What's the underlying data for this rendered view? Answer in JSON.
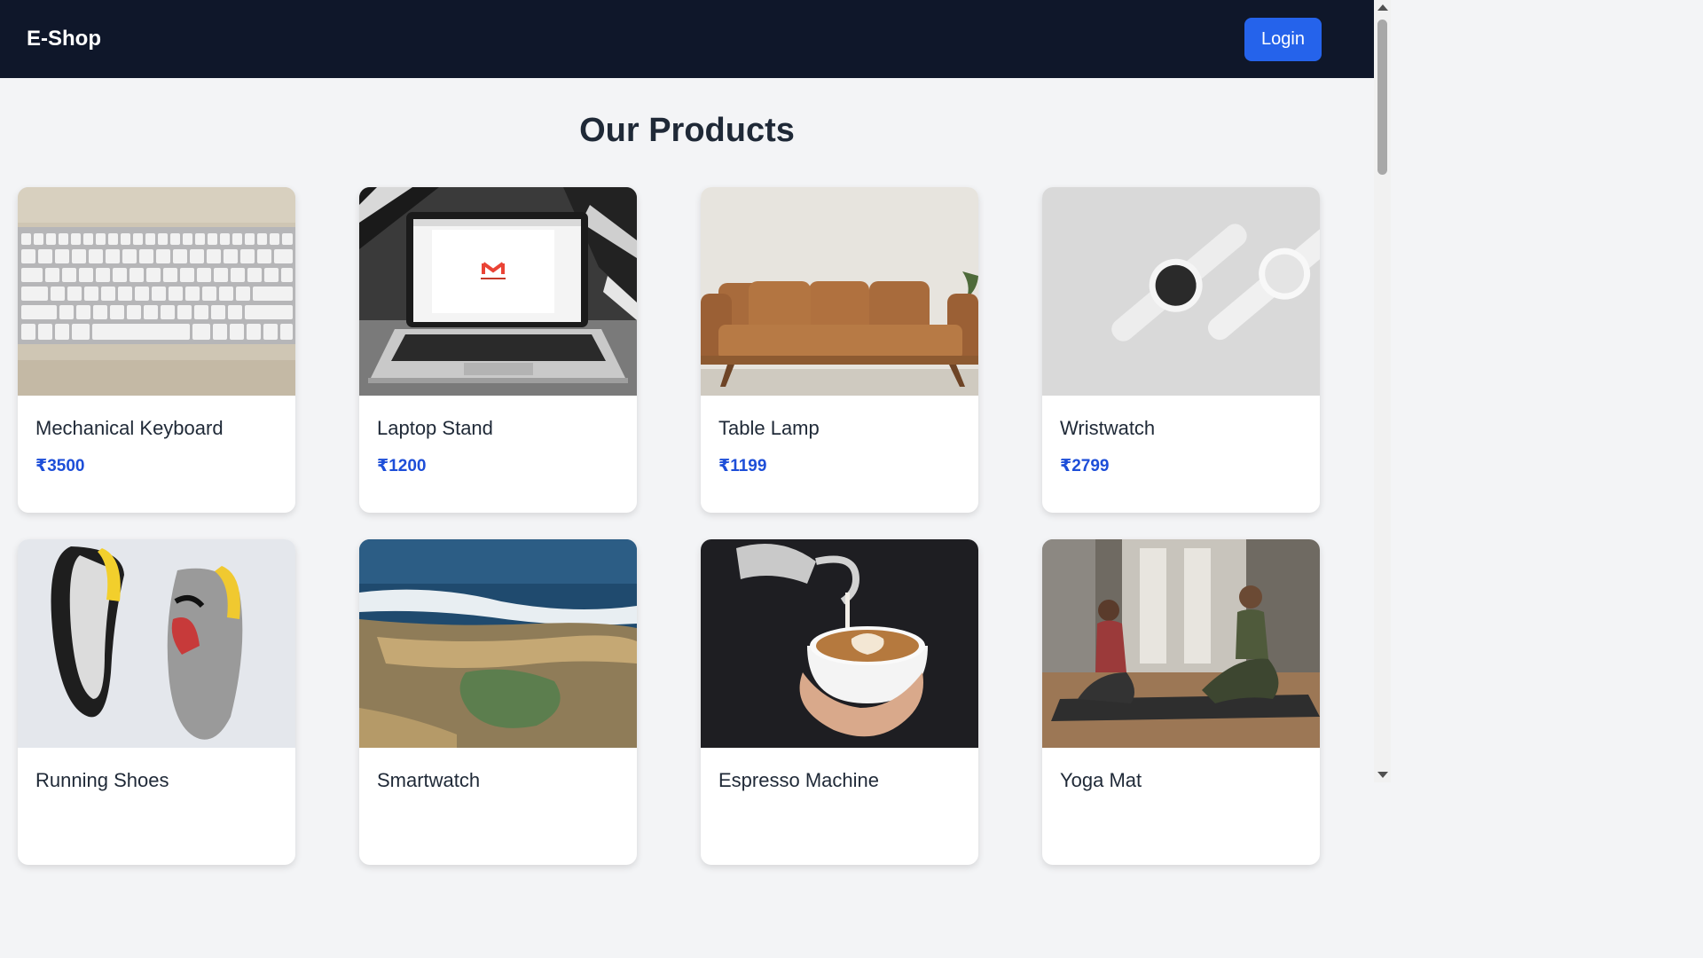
{
  "header": {
    "brand": "E-Shop",
    "login_label": "Login"
  },
  "main": {
    "title": "Our Products",
    "products": [
      {
        "name": "Mechanical Keyboard",
        "price": "₹3500",
        "image": "keyboard-image"
      },
      {
        "name": "Laptop Stand",
        "price": "₹1200",
        "image": "laptop-image"
      },
      {
        "name": "Table Lamp",
        "price": "₹1199",
        "image": "sofa-image"
      },
      {
        "name": "Wristwatch",
        "price": "₹2799",
        "image": "watch-image"
      },
      {
        "name": "Running Shoes",
        "price": "",
        "image": "shoes-image"
      },
      {
        "name": "Smartwatch",
        "price": "",
        "image": "sea-rocks-image"
      },
      {
        "name": "Espresso Machine",
        "price": "",
        "image": "coffee-image"
      },
      {
        "name": "Yoga Mat",
        "price": "",
        "image": "yoga-image"
      }
    ]
  },
  "colors": {
    "navbar": "#0f172a",
    "accent": "#2563eb",
    "price": "#1d4ed8",
    "background": "#f3f4f6"
  }
}
